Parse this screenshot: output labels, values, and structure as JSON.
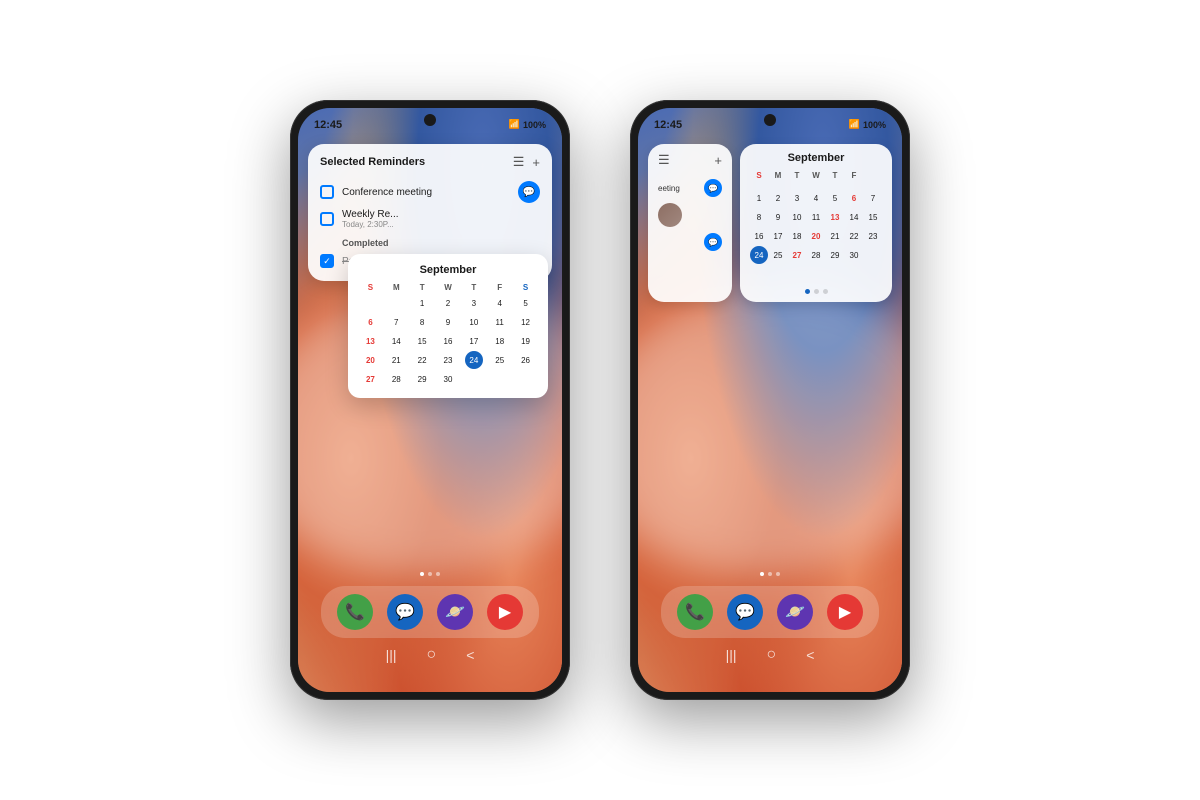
{
  "page": {
    "background": "#ffffff"
  },
  "phone1": {
    "status": {
      "time": "12:45",
      "signal": "WiFi",
      "battery": "100%"
    },
    "widget": {
      "title": "Selected Reminders",
      "reminders": [
        {
          "id": 1,
          "text": "Conference meeting",
          "completed": false,
          "has_bubble": true
        },
        {
          "id": 2,
          "text": "Weekly Re...",
          "sub": "Today, 2:30P...",
          "completed": false,
          "has_bubble": false
        }
      ],
      "completed_label": "Completed",
      "completed_items": [
        {
          "id": 3,
          "text": "Pay the bi...",
          "completed": true
        }
      ]
    },
    "calendar": {
      "month": "September",
      "headers": [
        "S",
        "M",
        "T",
        "W",
        "T",
        "F",
        "S"
      ],
      "weeks": [
        [
          "",
          "",
          "1",
          "2",
          "3",
          "4",
          "5"
        ],
        [
          "6",
          "7",
          "8",
          "9",
          "10",
          "11",
          "12"
        ],
        [
          "13",
          "14",
          "15",
          "16",
          "17",
          "18",
          "19"
        ],
        [
          "20",
          "21",
          "22",
          "23",
          "24",
          "25",
          "26"
        ],
        [
          "27",
          "28",
          "29",
          "30",
          "",
          "",
          ""
        ]
      ],
      "today": "24",
      "red_days": [
        "6",
        "13",
        "20",
        "27"
      ],
      "event_days": {
        "1": "blue",
        "5": "red",
        "24": "today"
      }
    },
    "dock": {
      "apps": [
        {
          "name": "Phone",
          "color": "phone"
        },
        {
          "name": "Chat",
          "color": "chat"
        },
        {
          "name": "Planet",
          "color": "planet"
        },
        {
          "name": "Video",
          "color": "video"
        }
      ]
    }
  },
  "phone2": {
    "status": {
      "time": "12:45",
      "signal": "WiFi",
      "battery": "100%"
    },
    "mini_widget": {
      "items": [
        {
          "text": "eeting",
          "has_bubble": true
        },
        {
          "text": "",
          "has_avatar": true
        },
        {
          "text": "",
          "has_bubble": true
        }
      ]
    },
    "calendar": {
      "month": "September",
      "headers": [
        "S",
        "M",
        "T",
        "W",
        "T",
        "F"
      ],
      "weeks": [
        [
          "",
          "1",
          "2",
          "3",
          "4",
          "5"
        ],
        [
          "6",
          "7",
          "8",
          "9",
          "10",
          "11"
        ],
        [
          "13",
          "14",
          "15",
          "16",
          "17",
          "18"
        ],
        [
          "20",
          "21",
          "22",
          "23",
          "24",
          "25"
        ],
        [
          "27",
          "28",
          "29",
          "30",
          "",
          ""
        ]
      ],
      "today": "24",
      "red_days": [
        "6",
        "13",
        "20",
        "27"
      ]
    },
    "dock": {
      "apps": [
        {
          "name": "Phone",
          "color": "phone"
        },
        {
          "name": "Chat",
          "color": "chat"
        },
        {
          "name": "Planet",
          "color": "planet"
        },
        {
          "name": "Video",
          "color": "video"
        }
      ]
    }
  },
  "icons": {
    "list": "☰",
    "plus": "+",
    "checkmark": "✓",
    "phone": "📞",
    "chat": "💬",
    "planet": "🪐",
    "video": "▶",
    "nav_menu": "|||",
    "nav_home": "○",
    "nav_back": "<"
  }
}
